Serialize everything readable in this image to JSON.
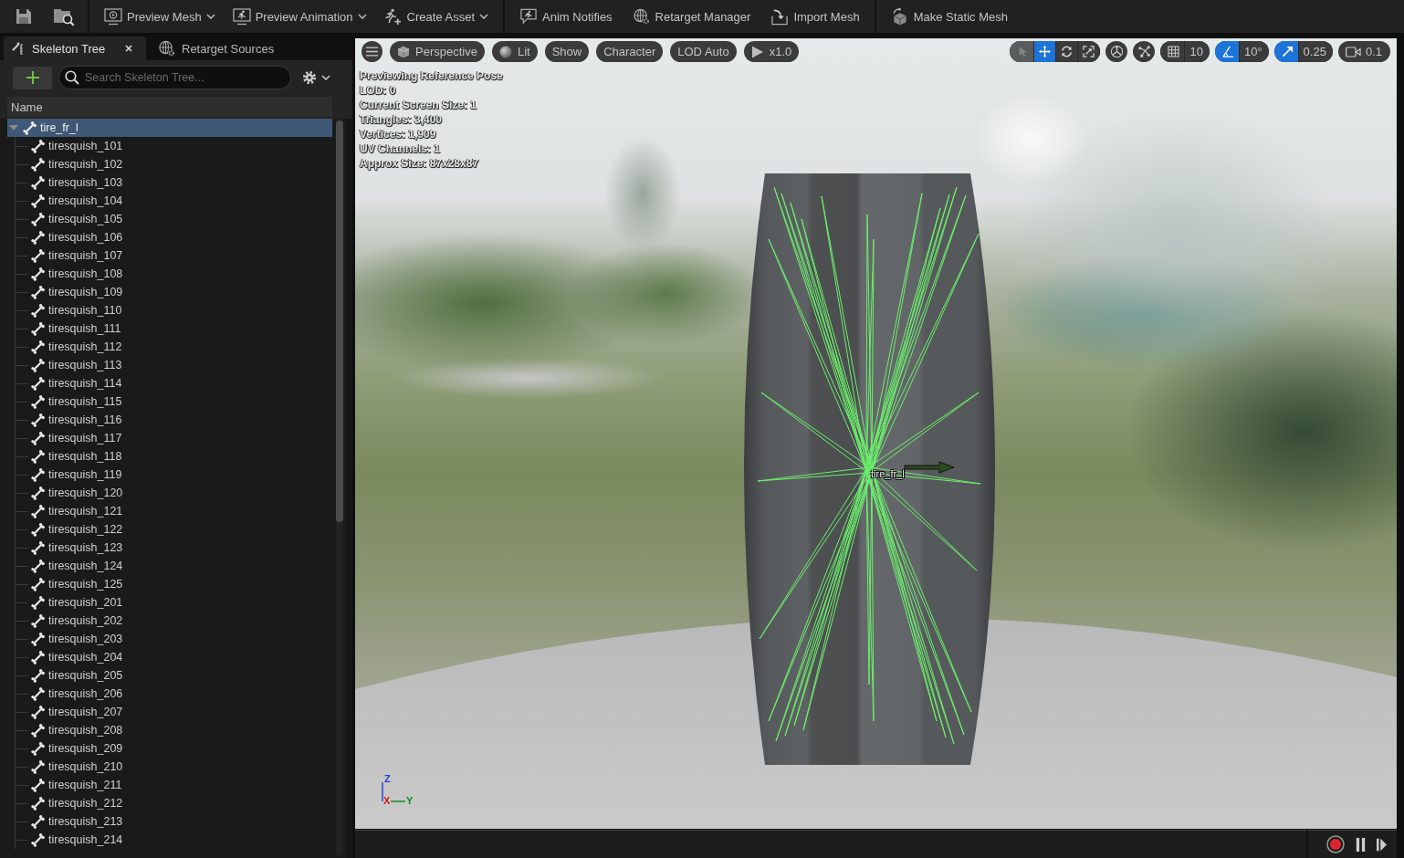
{
  "main_toolbar": {
    "groups": [
      {
        "items": [
          {
            "label": "Preview Mesh",
            "dropdown": true
          },
          {
            "label": "Preview Animation",
            "dropdown": true
          },
          {
            "label": "Create Asset",
            "dropdown": true
          }
        ]
      },
      {
        "items": [
          {
            "label": "Anim Notifies",
            "dropdown": false
          },
          {
            "label": "Retarget Manager",
            "dropdown": false
          },
          {
            "label": "Import Mesh",
            "dropdown": false
          }
        ]
      },
      {
        "items": [
          {
            "label": "Make Static Mesh",
            "dropdown": false
          }
        ]
      }
    ]
  },
  "skeleton_panel": {
    "tabs": [
      {
        "label": "Skeleton Tree",
        "selected": true
      },
      {
        "label": "Retarget Sources",
        "selected": false
      }
    ],
    "search": {
      "placeholder": "Search Skeleton Tree..."
    },
    "column_header": "Name",
    "tree": [
      {
        "label": "tire_fr_l",
        "selected": true,
        "expanded": true,
        "children": [
          {
            "label": "tiresquish_101",
            "selected": false
          },
          {
            "label": "tiresquish_102",
            "selected": false
          },
          {
            "label": "tiresquish_103",
            "selected": false
          },
          {
            "label": "tiresquish_104",
            "selected": false
          },
          {
            "label": "tiresquish_105",
            "selected": false
          },
          {
            "label": "tiresquish_106",
            "selected": false
          },
          {
            "label": "tiresquish_107",
            "selected": false
          },
          {
            "label": "tiresquish_108",
            "selected": false
          },
          {
            "label": "tiresquish_109",
            "selected": false
          },
          {
            "label": "tiresquish_110",
            "selected": false
          },
          {
            "label": "tiresquish_111",
            "selected": false
          },
          {
            "label": "tiresquish_112",
            "selected": false
          },
          {
            "label": "tiresquish_113",
            "selected": false
          },
          {
            "label": "tiresquish_114",
            "selected": false
          },
          {
            "label": "tiresquish_115",
            "selected": false
          },
          {
            "label": "tiresquish_116",
            "selected": false
          },
          {
            "label": "tiresquish_117",
            "selected": false
          },
          {
            "label": "tiresquish_118",
            "selected": false
          },
          {
            "label": "tiresquish_119",
            "selected": false
          },
          {
            "label": "tiresquish_120",
            "selected": false
          },
          {
            "label": "tiresquish_121",
            "selected": false
          },
          {
            "label": "tiresquish_122",
            "selected": false
          },
          {
            "label": "tiresquish_123",
            "selected": false
          },
          {
            "label": "tiresquish_124",
            "selected": false
          },
          {
            "label": "tiresquish_125",
            "selected": false
          },
          {
            "label": "tiresquish_201",
            "selected": false
          },
          {
            "label": "tiresquish_202",
            "selected": false
          },
          {
            "label": "tiresquish_203",
            "selected": false
          },
          {
            "label": "tiresquish_204",
            "selected": false
          },
          {
            "label": "tiresquish_205",
            "selected": false
          },
          {
            "label": "tiresquish_206",
            "selected": false
          },
          {
            "label": "tiresquish_207",
            "selected": false
          },
          {
            "label": "tiresquish_208",
            "selected": false
          },
          {
            "label": "tiresquish_209",
            "selected": false
          },
          {
            "label": "tiresquish_210",
            "selected": false
          },
          {
            "label": "tiresquish_211",
            "selected": false
          },
          {
            "label": "tiresquish_212",
            "selected": false
          },
          {
            "label": "tiresquish_213",
            "selected": false
          },
          {
            "label": "tiresquish_214",
            "selected": false
          }
        ]
      }
    ]
  },
  "viewport": {
    "view_buttons": [
      {
        "label": "Perspective"
      },
      {
        "label": "Lit"
      },
      {
        "label": "Show"
      },
      {
        "label": "Character"
      },
      {
        "label": "LOD Auto"
      },
      {
        "label": "x1.0"
      }
    ],
    "transform_tools": [
      {
        "selected": false,
        "disabled": true
      },
      {
        "selected": true,
        "disabled": false
      },
      {
        "selected": false,
        "disabled": false
      },
      {
        "selected": false,
        "disabled": false
      }
    ],
    "snaps": [
      {
        "value": "10",
        "on": false
      },
      {
        "value": "10°",
        "on": true
      },
      {
        "value": "0.25",
        "on": true
      }
    ],
    "camera_speed": "0.1",
    "stats": [
      "Previewing Reference Pose",
      "LOD: 0",
      "Current Screen Size: 1",
      "Triangles: 3,400",
      "Vertices: 1,909",
      "UV Channels: 1",
      "Approx Size: 87x28x87"
    ],
    "bone_label": "tire_fr_l",
    "axis_labels": [
      "Z",
      "X",
      "Y"
    ]
  }
}
